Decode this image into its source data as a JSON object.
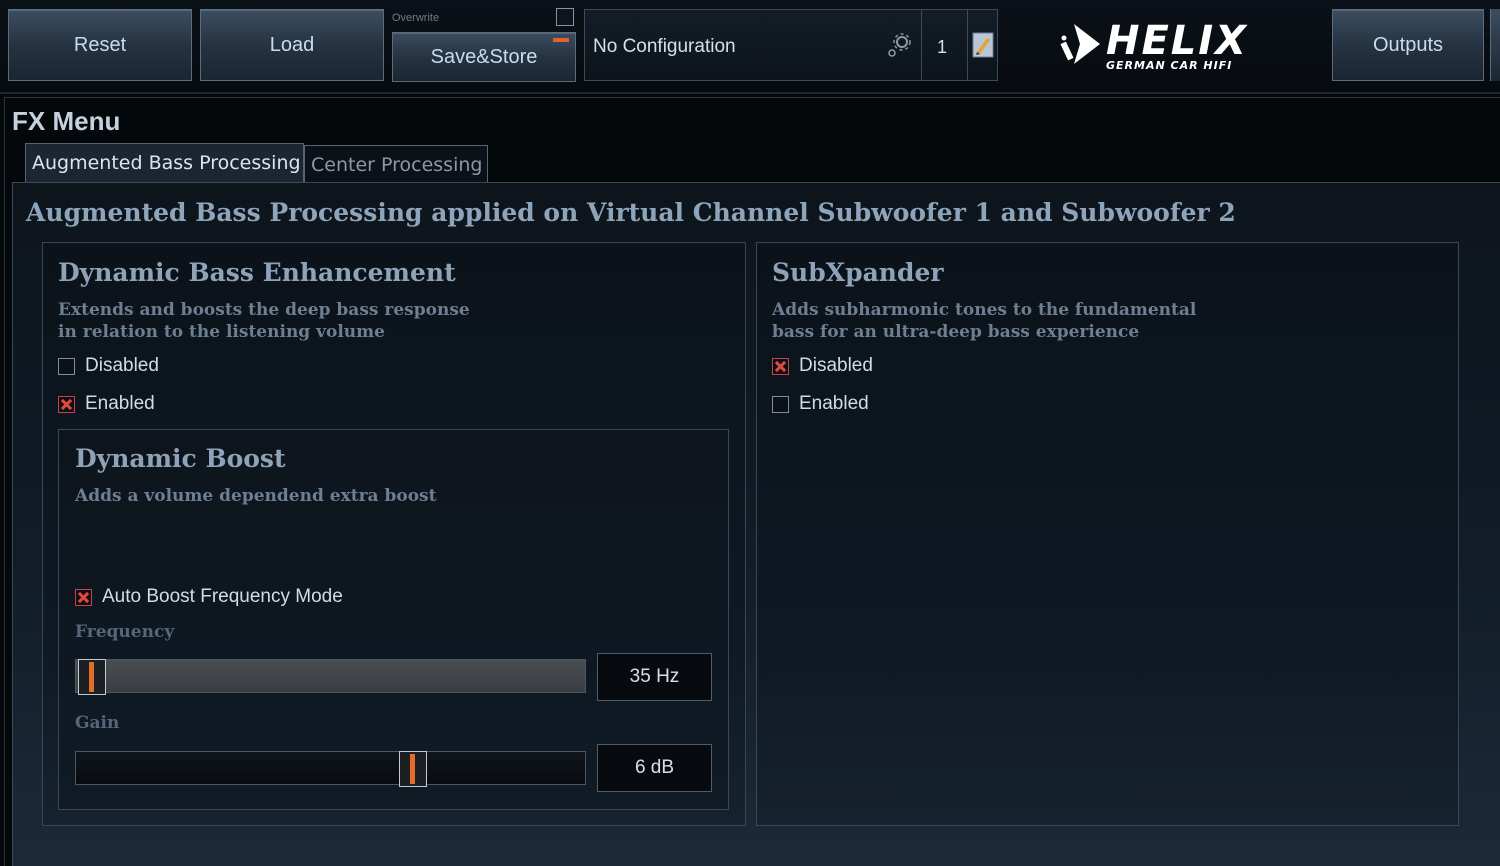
{
  "toolbar": {
    "reset_label": "Reset",
    "load_label": "Load",
    "overwrite_label": "Overwrite",
    "save_label": "Save&Store",
    "config_name": "No Configuration",
    "config_number": "1",
    "outputs_label": "Outputs",
    "accent_color": "#e2622b",
    "icons": [
      "gear-icon",
      "edit-icon"
    ]
  },
  "logo": {
    "brand": "HELIX",
    "tagline": "GERMAN CAR HIFI"
  },
  "fx_menu": {
    "title": "FX Menu",
    "tabs": [
      {
        "label": "Augmented Bass Processing",
        "active": true
      },
      {
        "label": "Center Processing",
        "active": false
      }
    ],
    "heading": "Augmented Bass Processing applied on Virtual Channel Subwoofer 1 and Subwoofer 2"
  },
  "dbe": {
    "title": "Dynamic Bass Enhancement",
    "desc_line1": "Extends and boosts the deep bass response",
    "desc_line2": "in relation to the listening volume",
    "options": [
      {
        "label": "Disabled",
        "checked": false
      },
      {
        "label": "Enabled",
        "checked": true
      }
    ],
    "boost": {
      "title": "Dynamic Boost",
      "desc": "Adds a volume dependend extra boost",
      "auto_mode_label": "Auto Boost Frequency Mode",
      "auto_mode_checked": true,
      "frequency_label": "Frequency",
      "frequency_value": "35 Hz",
      "frequency_level": 0.0,
      "gain_label": "Gain",
      "gain_value": "6 dB",
      "gain_level": 0.67
    }
  },
  "subx": {
    "title": "SubXpander",
    "desc_line1": "Adds subharmonic tones to the fundamental",
    "desc_line2": "bass for an ultra-deep bass experience",
    "options": [
      {
        "label": "Disabled",
        "checked": true
      },
      {
        "label": "Enabled",
        "checked": false
      }
    ]
  }
}
